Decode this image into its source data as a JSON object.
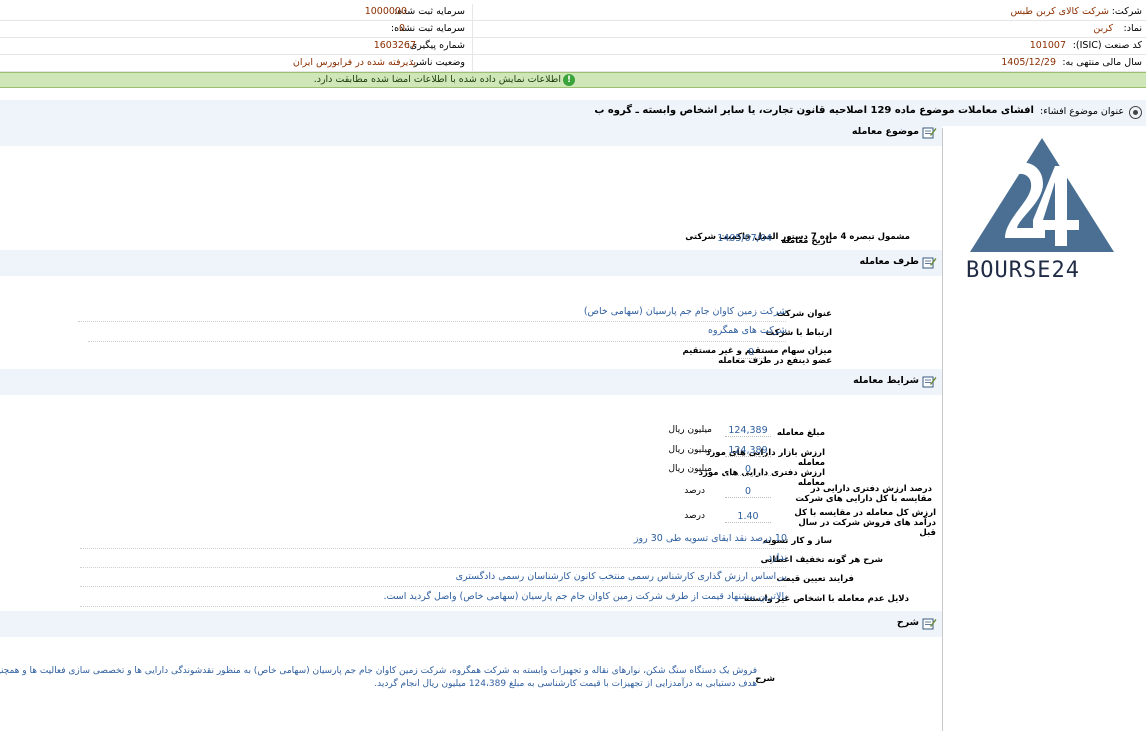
{
  "header": {
    "rows": [
      {
        "right_label": "شرکت:",
        "right_value": "شرکت کالای کربن طبس",
        "left_label": "سرمایه ثبت شده:",
        "left_value": "1000000"
      },
      {
        "right_label": "نماد:",
        "right_value": "کربن",
        "left_label": "سرمایه ثبت نشده:",
        "left_value": "0"
      },
      {
        "right_label": "کد صنعت (ISIC):",
        "right_value": "101007",
        "left_label": "شماره پیگیری:",
        "left_value": "1603267"
      },
      {
        "right_label": "سال مالی منتهی به:",
        "right_value": "1405/12/29",
        "left_label": "وضعیت ناشر:",
        "left_value": "پذیرفته شده در فرابورس ایران"
      }
    ]
  },
  "notice": {
    "icon": "info-icon",
    "text": "اطلاعات نمایش داده شده با اطلاعات امضا شده مطابقت دارد."
  },
  "subject": {
    "label": "عنوان موضوع افشاء:",
    "value": "افشای معاملات موضوع ماده 129 اصلاحیه قانون تجارت، یا سایر اشخاص وابسته ـ گروه ب"
  },
  "sections": {
    "topic": {
      "title": "موضوع معامله",
      "included_note": "مشمول تبصره 4 ماده 7 دستور العمل حاکمیت شرکتی",
      "date_label": "تاریخ معامله",
      "date_value": "1405/07/04"
    },
    "party": {
      "title": "طرف معامله",
      "company_label": "عنوان شرکت",
      "company_value": "شرکت زمین کاوان جام جم پارسیان (سهامی خاص)",
      "relation_label": "ارتباط با شرکت",
      "relation_value": "شرکت های همگروه",
      "shares_label": "میزان سهام مستقیم و غیر مستقیم عضو ذینفع در طرف معامله",
      "shares_value": "0"
    },
    "terms": {
      "title": "شرایط معامله",
      "rows": [
        {
          "label": "مبلغ معامله",
          "value": "124,389",
          "unit": "میلیون ریال"
        },
        {
          "label": "ارزش بازار دارایی های مورد معامله",
          "value": "124,389",
          "unit": "میلیون ریال"
        },
        {
          "label": "ارزش دفتری دارایی های مورد معامله",
          "value": "0",
          "unit": "میلیون ریال"
        },
        {
          "label": "درصد ارزش دفتری دارایی در مقایسه با کل دارایی های شرکت",
          "value": "0",
          "unit": "درصد"
        },
        {
          "label": "ارزش کل معامله در مقایسه با کل درآمد های فروش شرکت در سال قبل",
          "value": "1.40",
          "unit": "درصد"
        }
      ],
      "settlement_label": "ساز و کار تسویه",
      "settlement_value": "10 درصد نقد ‌‌ابقای تسویه طی 30 روز",
      "discount_label": "شرح هر گونه تخفیف اعطایی",
      "discount_value": "ندارد",
      "pricing_label": "فرایند تعیین قیمت",
      "pricing_value": "بر اساس ارزش گذاری کارشناس رسمی منتخب کانون کارشناسان رسمی دادگستری",
      "reason_label": "دلایل عدم معامله با اشخاص غیر وابسته",
      "reason_value": "بالاترین پیشنهاد قیمت از طرف شرکت زمین کاوان جام جم پارسیان (سهامی خاص) واصل گردید است."
    },
    "desc": {
      "title": "شرح",
      "label": "شرح",
      "line1": "فروش یک دستگاه سنگ شکن، نوارهای نقاله و تجهیزات وابسته به شرکت همگروه، شرکت زمین کاوان جام جم پارسیان (سهامی خاص) به منظور نقدشوندگی دارایی ها و تخصصی سازی فعالیت ها و همچنین با",
      "line2": "هدف دستیابی به درآمدزایی از تجهیزات با قیمت کارشناسی به مبلغ 124،389 میلیون ریال انجام گردید."
    }
  },
  "logo": {
    "text": "BOURSE24",
    "color": "#4a6f93"
  }
}
